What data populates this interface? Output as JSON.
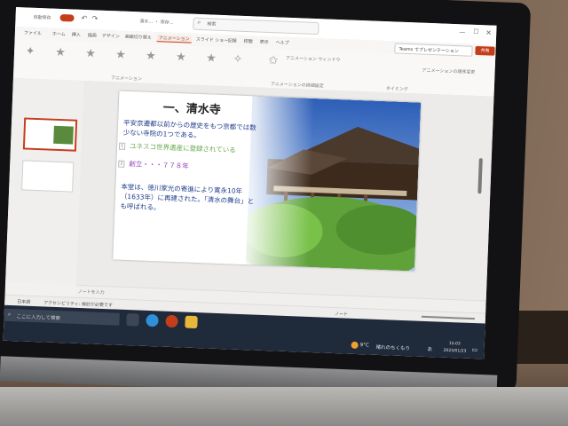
{
  "window": {
    "autosave_label": "自動保存",
    "doc_title": "清水… ・ 保存…",
    "search_placeholder": "検索"
  },
  "menu": [
    "ファイル",
    "ホーム",
    "挿入",
    "描画",
    "デザイン",
    "画面切り替え",
    "アニメーション",
    "スライド ショー",
    "記録",
    "校閲",
    "表示",
    "ヘルプ"
  ],
  "ribbon": {
    "teams_label": "Teams でプレゼンテーション",
    "share_label": "共有",
    "animation_group_label": "アニメーション",
    "advanced_group_label": "アニメーションの詳細設定",
    "timing_group_label": "タイミング",
    "add_animation": "アニメーション ウィンドウ",
    "pane_title": "アニメーションの順序変更"
  },
  "slide": {
    "title": "一、清水寺",
    "lines": [
      "平安京遷都以前からの歴史をもつ京都では数",
      "少ない寺院の1つである。",
      "ユネスコ世界遺産に登録されている",
      "創立・・・７７８年",
      "本堂は、徳川家光の寄進により寛永10年",
      "（1633年）に再建された。「清水の舞台」と",
      "も呼ばれる。"
    ],
    "anim_markers": [
      "1",
      "2"
    ]
  },
  "notes": {
    "placeholder": "ノートを入力"
  },
  "status": {
    "lang": "日本語",
    "accessibility": "アクセシビリティ: 検討が必要です",
    "notes_btn": "ノート"
  },
  "taskbar": {
    "search_placeholder": "ここに入力して検索",
    "weather_temp": "9°C",
    "weather_text": "晴れのちくもり",
    "ime": "あ",
    "time": "15:03",
    "date": "2023/01/23"
  },
  "colors": {
    "accent": "#c43e1c",
    "title_text": "#222222",
    "body_blue": "#1f3c8a",
    "heritage_green": "#6aa84f",
    "founded_purple": "#8e3ab8"
  }
}
